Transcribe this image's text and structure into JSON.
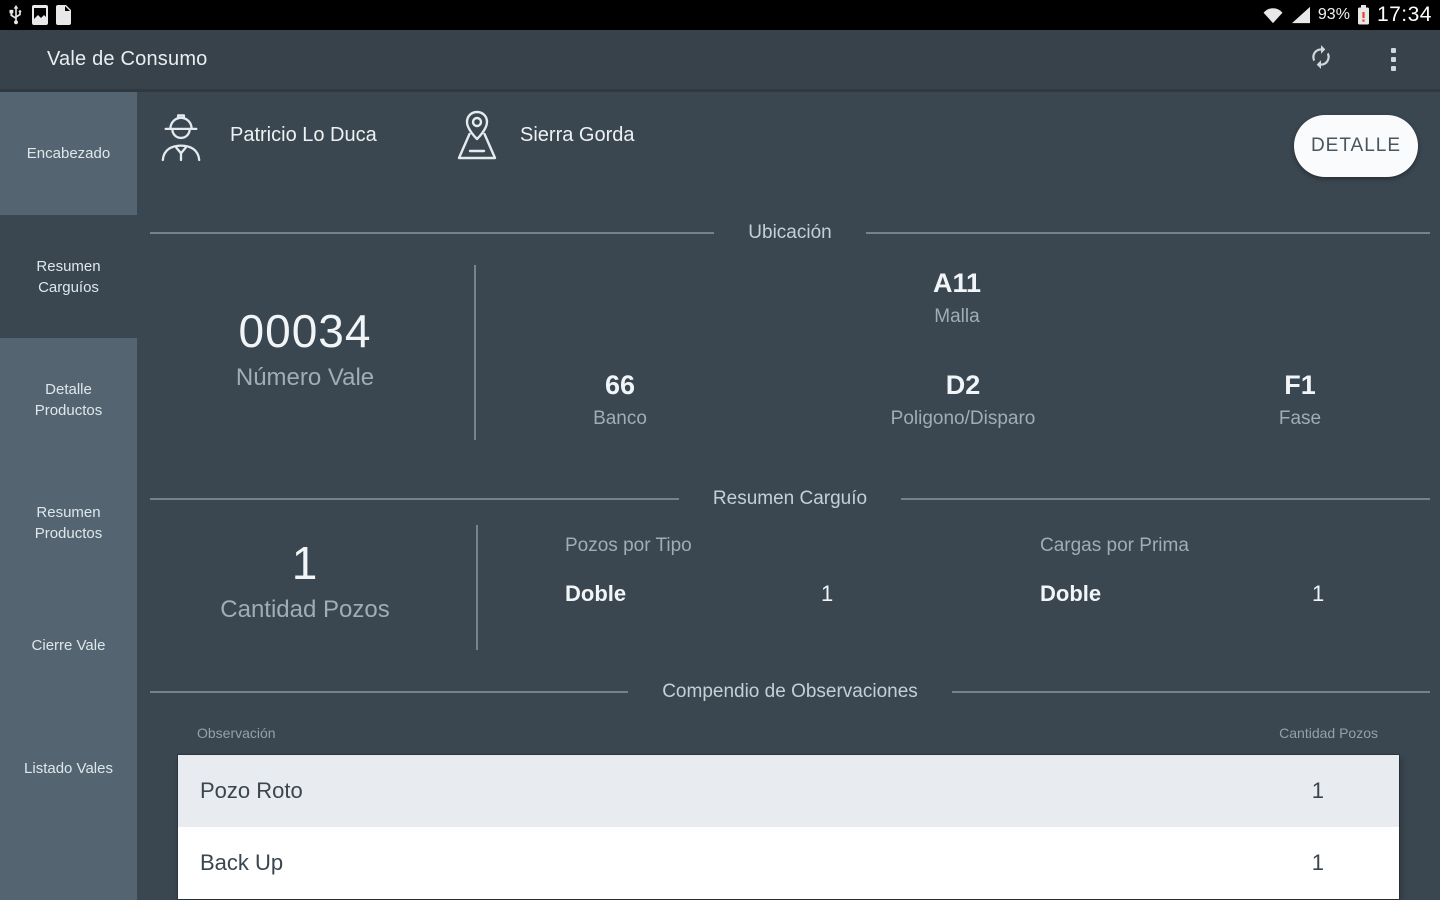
{
  "colors": {
    "status_bar_bg": "#000000",
    "app_bar_bg": "#37424b",
    "content_bg": "#3a4650",
    "sidebar_bg": "#546470",
    "divider": "#73828c",
    "label_text": "#9fadb6",
    "value_text": "#f1f5f7",
    "section_title": "#c5cfd6",
    "table_row_alt": "#e8ecf0",
    "table_row": "#ffffff",
    "table_text": "#3a454e",
    "button_bg": "#fafbfc",
    "button_text": "#4a555e",
    "battery_alert": "#e8442a"
  },
  "status_bar": {
    "time": "17:34",
    "battery_pct": "93%",
    "left_icons": [
      "usb-icon",
      "screenshot-icon",
      "file-alert-icon"
    ],
    "right_icons": [
      "wifi-icon",
      "signal-icon",
      "battery-icon"
    ]
  },
  "app_bar": {
    "title": "Vale de Consumo",
    "actions": [
      "refresh-icon",
      "overflow-menu-icon"
    ]
  },
  "sidebar": {
    "items": [
      {
        "label": "Encabezado",
        "selected": false
      },
      {
        "label": "Resumen Carguíos",
        "selected": true
      },
      {
        "label": "Detalle Productos",
        "selected": false
      },
      {
        "label": "Resumen Productos",
        "selected": false
      },
      {
        "label": "Cierre Vale",
        "selected": false
      },
      {
        "label": "Listado Vales",
        "selected": false
      }
    ]
  },
  "header": {
    "operator_name": "Patricio Lo Duca",
    "site_name": "Sierra Gorda",
    "detail_button_label": "DETALLE"
  },
  "ubicacion": {
    "title": "Ubicación",
    "numero_vale": {
      "value": "00034",
      "label": "Número Vale"
    },
    "banco": {
      "value": "66",
      "label": "Banco"
    },
    "malla": {
      "value": "A11",
      "label": "Malla"
    },
    "poligono": {
      "value": "D2",
      "label": "Poligono/Disparo"
    },
    "fase": {
      "value": "F1",
      "label": "Fase"
    }
  },
  "resumen_carguio": {
    "title": "Resumen Carguío",
    "cantidad_pozos": {
      "value": "1",
      "label": "Cantidad Pozos"
    },
    "pozos_por_tipo": {
      "label": "Pozos por Tipo",
      "rows": [
        {
          "name": "Doble",
          "value": "1"
        }
      ]
    },
    "cargas_por_prima": {
      "label": "Cargas por Prima",
      "rows": [
        {
          "name": "Doble",
          "value": "1"
        }
      ]
    }
  },
  "observaciones": {
    "title": "Compendio de Observaciones",
    "col_observacion": "Observación",
    "col_cantidad": "Cantidad Pozos",
    "rows": [
      {
        "name": "Pozo Roto",
        "value": "1"
      },
      {
        "name": "Back Up",
        "value": "1"
      }
    ]
  }
}
